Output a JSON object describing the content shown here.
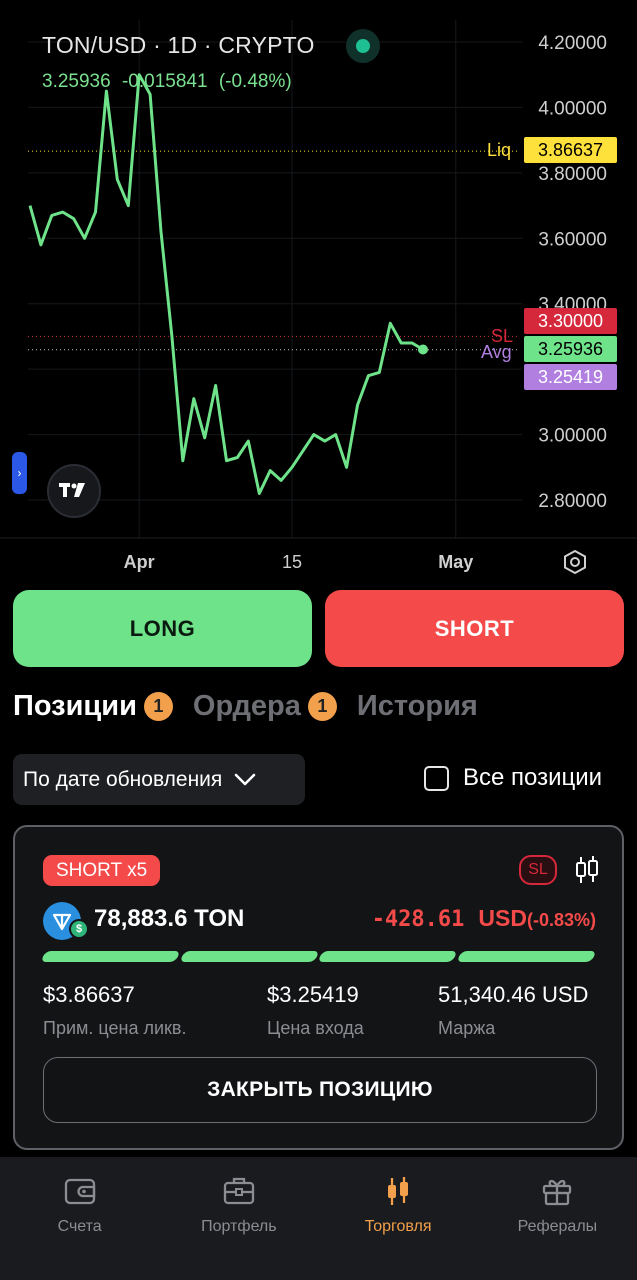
{
  "chart": {
    "symbol": "TON/USD · 1D · CRYPTO",
    "last_price": "3.25936",
    "change": "-0.015841",
    "change_pct": "(-0.48%)",
    "price_axis": [
      "4.20000",
      "4.00000",
      "3.80000",
      "3.60000",
      "3.40000",
      "3.00000",
      "2.80000"
    ],
    "time_axis": [
      "Apr",
      "15",
      "May"
    ],
    "liq_label": "Liq",
    "liq_price": "3.86637",
    "sl_label": "SL",
    "sl_price": "3.30000",
    "current_price": "3.25936",
    "avg_label": "Avg",
    "avg_price": "3.25419",
    "colors": {
      "line": "#6ee38a",
      "liq": "#ffe13b",
      "sl": "#d6283b",
      "avg": "#b07fe0"
    }
  },
  "chart_data": {
    "type": "line",
    "y": [
      3.7,
      3.58,
      3.67,
      3.68,
      3.66,
      3.6,
      3.68,
      4.05,
      3.78,
      3.7,
      4.1,
      4.04,
      3.62,
      3.3,
      2.92,
      3.11,
      2.99,
      3.15,
      2.92,
      2.93,
      2.98,
      2.82,
      2.89,
      2.86,
      2.9,
      2.95,
      3.0,
      2.98,
      3.0,
      2.9,
      3.09,
      3.18,
      3.19,
      3.34,
      3.28,
      3.28,
      3.26
    ],
    "ylim": [
      2.72,
      4.25
    ],
    "x_ticks": [
      {
        "label": "Apr",
        "index": 10
      },
      {
        "label": "15",
        "index": 24
      },
      {
        "label": "May",
        "index": 39
      }
    ]
  },
  "actions": {
    "long": "LONG",
    "short": "SHORT"
  },
  "tabs": [
    {
      "label": "Позиции",
      "badge": "1"
    },
    {
      "label": "Ордера",
      "badge": "1"
    },
    {
      "label": "История"
    }
  ],
  "filter": {
    "sort_label": "По дате обновления",
    "all_positions": "Все позиции"
  },
  "position": {
    "side": "SHORT x5",
    "sl_badge": "SL",
    "amount": "78,883.6 TON",
    "pnl_value": "-428.61",
    "pnl_currency": "USD",
    "pnl_pct": "(-0.83%)",
    "liq_price": "$3.86637",
    "liq_label": "Прим. цена ликв.",
    "entry_price": "$3.25419",
    "entry_label": "Цена входа",
    "margin": "51,340.46 USD",
    "margin_label": "Маржа",
    "close_label": "ЗАКРЫТЬ ПОЗИЦИЮ"
  },
  "nav": [
    {
      "label": "Счета",
      "icon": "wallet-icon"
    },
    {
      "label": "Портфель",
      "icon": "briefcase-icon"
    },
    {
      "label": "Торговля",
      "icon": "candles-icon"
    },
    {
      "label": "Рефералы",
      "icon": "gift-icon"
    }
  ]
}
